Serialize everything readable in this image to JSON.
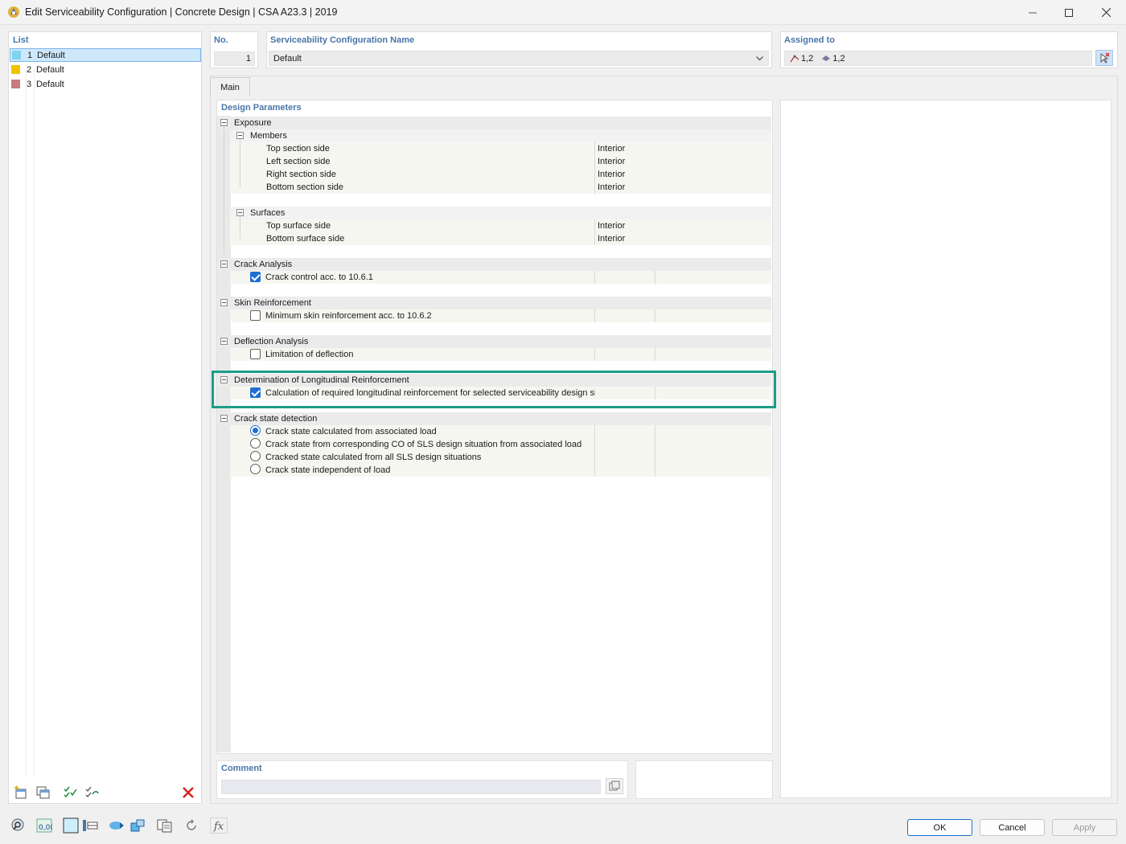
{
  "window": {
    "title": "Edit Serviceability Configuration | Concrete Design | CSA A23.3 | 2019",
    "controls": [
      "minimize-icon",
      "maximize-icon",
      "close-icon"
    ]
  },
  "list": {
    "header": "List",
    "items": [
      {
        "num": "1",
        "label": "Default",
        "color": "#7fd3ee",
        "selected": true
      },
      {
        "num": "2",
        "label": "Default",
        "color": "#f2c200",
        "selected": false
      },
      {
        "num": "3",
        "label": "Default",
        "color": "#c77b7b",
        "selected": false
      }
    ]
  },
  "header": {
    "no_label": "No.",
    "no_value": "1",
    "name_label": "Serviceability Configuration Name",
    "name_value": "Default",
    "assigned_label": "Assigned to",
    "assigned_members": "1,2",
    "assigned_surfaces": "1,2"
  },
  "tabs": [
    {
      "label": "Main",
      "active": true
    }
  ],
  "design": {
    "title": "Design Parameters",
    "exposure": {
      "label": "Exposure",
      "members": {
        "label": "Members",
        "rows": [
          {
            "label": "Top section side",
            "value": "Interior"
          },
          {
            "label": "Left section side",
            "value": "Interior"
          },
          {
            "label": "Right section side",
            "value": "Interior"
          },
          {
            "label": "Bottom section side",
            "value": "Interior"
          }
        ]
      },
      "surfaces": {
        "label": "Surfaces",
        "rows": [
          {
            "label": "Top surface side",
            "value": "Interior"
          },
          {
            "label": "Bottom surface side",
            "value": "Interior"
          }
        ]
      }
    },
    "crack_analysis": {
      "label": "Crack Analysis",
      "option": "Crack control acc. to 10.6.1",
      "checked": true
    },
    "skin": {
      "label": "Skin Reinforcement",
      "option": "Minimum skin reinforcement acc. to 10.6.2",
      "checked": false
    },
    "deflection": {
      "label": "Deflection Analysis",
      "option": "Limitation of deflection",
      "checked": false
    },
    "longitudinal": {
      "label": "Determination of Longitudinal Reinforcement",
      "option": "Calculation of required longitudinal reinforcement for selected serviceability design situa",
      "checked": true
    },
    "crack_state": {
      "label": "Crack state detection",
      "options": [
        {
          "label": "Crack state calculated from associated load",
          "selected": true
        },
        {
          "label": "Crack state from corresponding CO of SLS design situation from associated load",
          "selected": false
        },
        {
          "label": "Cracked state calculated from all SLS design situations",
          "selected": false
        },
        {
          "label": "Crack state independent of load",
          "selected": false
        }
      ]
    }
  },
  "comment": {
    "label": "Comment",
    "value": ""
  },
  "buttons": {
    "ok": "OK",
    "cancel": "Cancel",
    "apply": "Apply"
  },
  "bottom_tools": [
    "search-icon",
    "decimal-icon",
    "color-icon",
    "units-icon",
    "view-icon",
    "model-icon",
    "copy-table-icon",
    "reset-icon",
    "formula-icon"
  ],
  "list_tools": [
    "new-item-icon",
    "copy-item-icon",
    "check-all-icon",
    "uncheck-icon",
    "delete-icon"
  ],
  "highlight_color": "#1a9e86"
}
